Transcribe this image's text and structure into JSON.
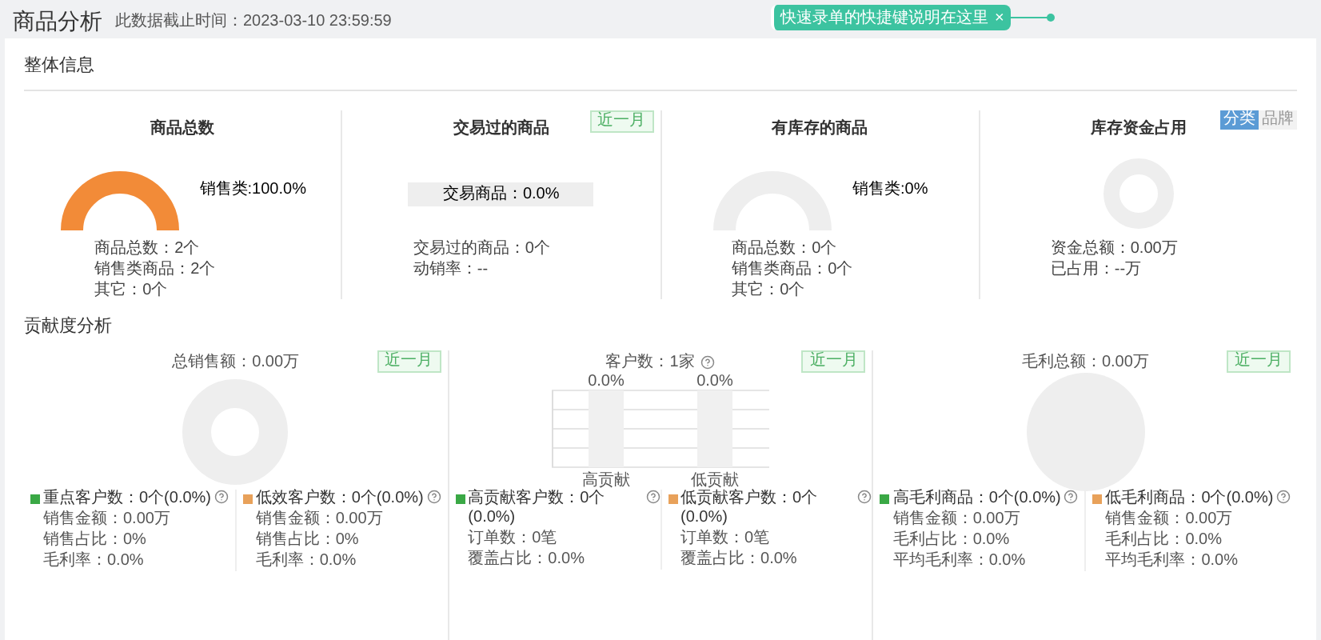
{
  "header": {
    "title": "商品分析",
    "subtitle": "此数据截止时间：2023-03-10 23:59:59"
  },
  "toast": {
    "text": "快速录单的快捷键说明在这里",
    "close": "×"
  },
  "overview": {
    "title": "整体信息",
    "cards": [
      {
        "kind": "half_donut",
        "title": "商品总数",
        "legend": "销售类:100.0%",
        "filled": true,
        "lines": [
          "商品总数：2个",
          "销售类商品：2个",
          "其它：0个"
        ]
      },
      {
        "kind": "bar",
        "title": "交易过的商品",
        "tag": "近一月",
        "bar_text": "交易商品：0.0%",
        "lines": [
          "交易过的商品：0个",
          "动销率：--"
        ]
      },
      {
        "kind": "half_donut",
        "title": "有库存的商品",
        "legend": "销售类:0%",
        "filled": false,
        "lines": [
          "商品总数：0个",
          "销售类商品：0个",
          "其它：0个"
        ]
      },
      {
        "kind": "ring",
        "title": "库存资金占用",
        "toggle": [
          {
            "label": "分类",
            "selected": true
          },
          {
            "label": "品牌",
            "selected": false
          }
        ],
        "lines": [
          "资金总额：0.00万",
          "已占用：--万"
        ]
      }
    ]
  },
  "contribution": {
    "title": "贡献度分析",
    "panels": [
      {
        "kind": "donut",
        "subtitle": "总销售额：0.00万",
        "tag": "近一月",
        "groups": [
          {
            "color": "#3aa845",
            "heading": "重点客户数：0个(0.0%)",
            "help": true,
            "lines": [
              "销售金额：0.00万",
              "销售占比：0%",
              "毛利率：0.0%"
            ]
          },
          {
            "color": "#e8a15a",
            "heading": "低效客户数：0个(0.0%)",
            "help": true,
            "lines": [
              "销售金额：0.00万",
              "销售占比：0%",
              "毛利率：0.0%"
            ]
          }
        ]
      },
      {
        "kind": "bar",
        "subtitle": "客户数：1家",
        "help": true,
        "tag": "近一月",
        "bars": [
          {
            "category": "高贡献",
            "reading": "0.0%"
          },
          {
            "category": "低贡献",
            "reading": "0.0%"
          }
        ],
        "groups": [
          {
            "color": "#3aa845",
            "heading": "高贡献客户数：0个(0.0%)",
            "help": true,
            "lines": [
              "订单数：0笔",
              "覆盖占比：0.0%"
            ]
          },
          {
            "color": "#e8a15a",
            "heading": "低贡献客户数：0个(0.0%)",
            "help": true,
            "lines": [
              "订单数：0笔",
              "覆盖占比：0.0%"
            ]
          }
        ]
      },
      {
        "kind": "pie",
        "subtitle": "毛利总额：0.00万",
        "tag": "近一月",
        "groups": [
          {
            "color": "#3aa845",
            "heading": "高毛利商品：0个(0.0%)",
            "help": true,
            "lines": [
              "销售金额：0.00万",
              "毛利占比：0.0%",
              "平均毛利率：0.0%"
            ]
          },
          {
            "color": "#e8a15a",
            "heading": "低毛利商品：0个(0.0%)",
            "help": true,
            "lines": [
              "销售金额：0.00万",
              "毛利占比：0.0%",
              "平均毛利率：0.0%"
            ]
          }
        ]
      }
    ]
  }
}
